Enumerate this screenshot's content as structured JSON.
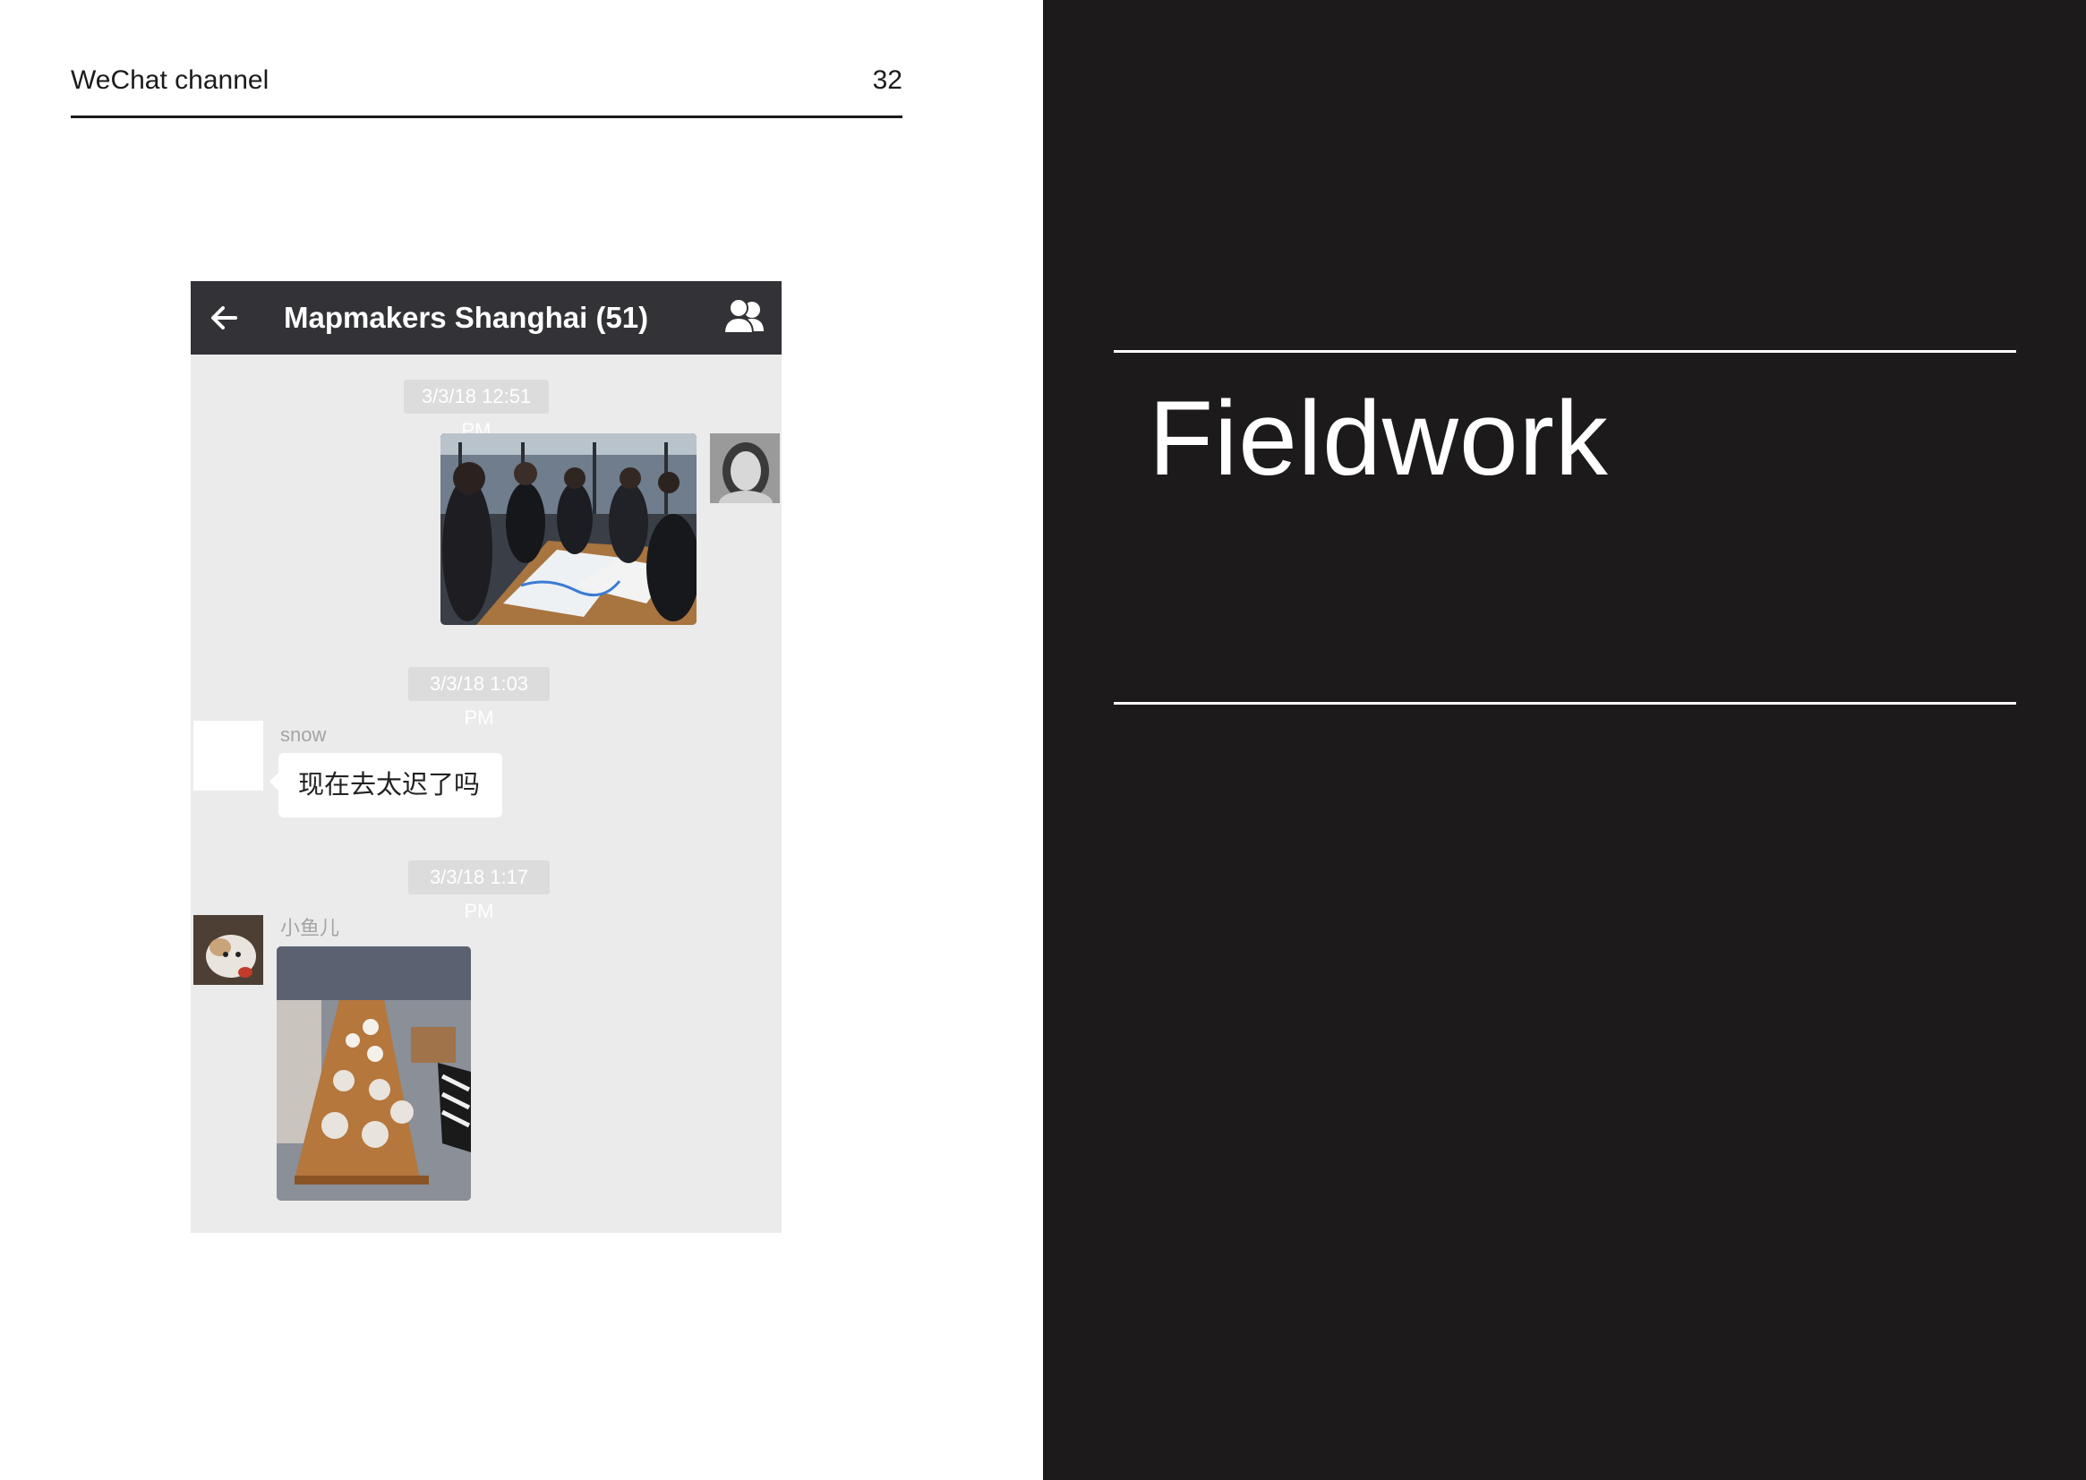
{
  "header": {
    "title": "WeChat channel",
    "page_number": "32"
  },
  "chat": {
    "title": "Mapmakers Shanghai (51)",
    "icons": {
      "back": "back-arrow-icon",
      "members": "group-members-icon"
    },
    "messages": [
      {
        "timestamp": "3/3/18 12:51 PM",
        "sender": "",
        "type": "image",
        "avatar": "avatar-photo",
        "image": "group-meeting-photo"
      },
      {
        "timestamp": "3/3/18 1:03 PM",
        "sender": "snow",
        "type": "text",
        "text": "现在去太迟了吗",
        "avatar": "blank-avatar"
      },
      {
        "timestamp": "3/3/18 1:17 PM",
        "sender": "小鱼儿",
        "type": "image",
        "avatar": "cat-avatar",
        "image": "tea-table-photo"
      }
    ]
  },
  "section": {
    "title": "Fieldwork"
  },
  "colors": {
    "dark_panel": "#1c1a1b",
    "titlebar": "#333337",
    "chat_background": "#ebebeb",
    "timestamp_pill": "#dcdcdc"
  }
}
